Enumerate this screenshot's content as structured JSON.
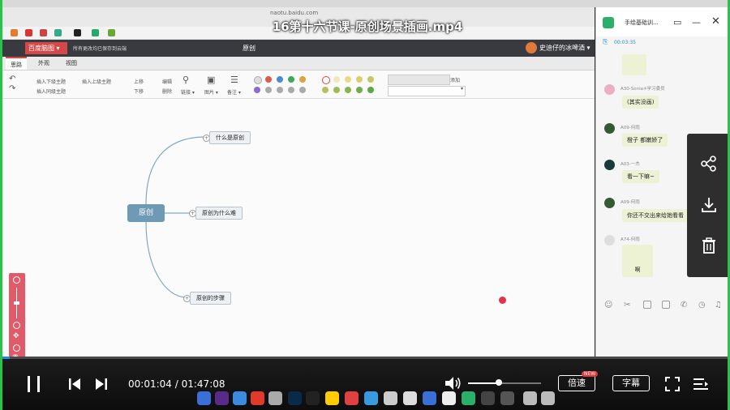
{
  "video": {
    "title": "16第十六节课-原创场景插画.mp4",
    "current_time": "00:01:04",
    "total_time": "01:47:08",
    "time_separator": "/",
    "progress": 0.01,
    "volume": 0.42,
    "speed_label": "倍速",
    "speed_badge": "NEW",
    "subtitle_label": "字幕"
  },
  "browser": {
    "url_small": "naotu.baidu.com"
  },
  "app": {
    "brand_label": "百度脑图 ▾",
    "saved_status": "所有更改均已保存到云端",
    "doc_title": "原创",
    "user_name": "史迪仔的冰啤酒 ▾",
    "tabs": [
      "思路",
      "外观",
      "视图"
    ],
    "toolbar": {
      "insert_child": "插入下级主题",
      "insert_parent": "插入上级主题",
      "insert_sibling": "插入同级主题",
      "move_up": "上移",
      "move_down": "下移",
      "edit": "编辑",
      "delete": "删除",
      "link": "链接 ▾",
      "image": "图片 ▾",
      "note": "备注 ▾",
      "add": "添加"
    }
  },
  "mindmap": {
    "root": "原创",
    "children": [
      "什么是原创",
      "原创为什么难",
      "原创的步骤"
    ]
  },
  "chat": {
    "title": "手绘基础训...",
    "elapsed": "00:03:35",
    "messages": [
      {
        "name": "A30-Sonia✳学习委员",
        "text": "(其实没画)"
      },
      {
        "name": "A09-何雨",
        "text": "橙子 都嫩娇了"
      },
      {
        "name": "A03-一杰",
        "text": "看一下嘛~"
      },
      {
        "name": "A09-何雨",
        "text": "你还不交出来给她看看"
      },
      {
        "name": "A74-何雨",
        "text": "啊"
      }
    ]
  },
  "colors": {
    "accent": "#1f8bd6",
    "brand": "#d44848",
    "root_node": "#6f9ab5",
    "border_green": "#29c24a"
  }
}
